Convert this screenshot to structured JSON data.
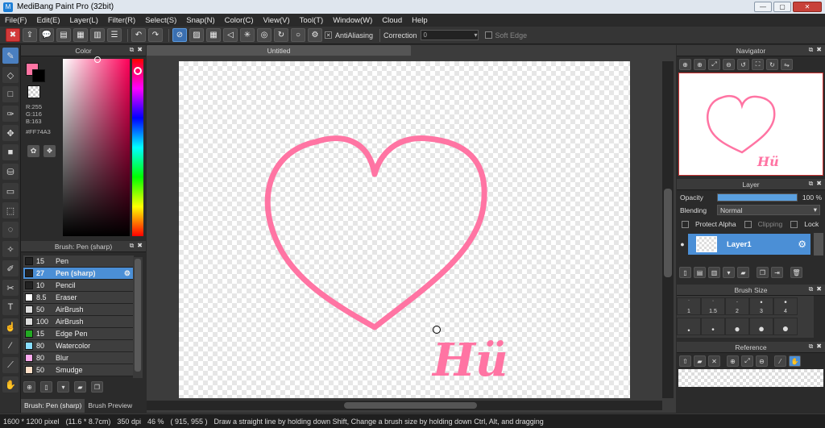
{
  "window": {
    "title": "MediBang Paint Pro (32bit)",
    "btn_min": "—",
    "btn_max": "▢",
    "btn_close": "✕"
  },
  "menu": [
    "File(F)",
    "Edit(E)",
    "Layer(L)",
    "Filter(R)",
    "Select(S)",
    "Snap(N)",
    "Color(C)",
    "View(V)",
    "Tool(T)",
    "Window(W)",
    "Cloud",
    "Help"
  ],
  "toolbar": {
    "antialiasing_label": "AntiAliasing",
    "correction_label": "Correction",
    "correction_value": "0",
    "soft_edge_label": "Soft Edge"
  },
  "color_panel": {
    "title": "Color",
    "r": "R:255",
    "g": "G:116",
    "b": "B:163",
    "hex": "#FF74A3",
    "fg_color": "#ff74a3"
  },
  "brush_panel": {
    "title": "Brush: Pen (sharp)",
    "items": [
      {
        "size": "15",
        "name": "Pen",
        "color": "#222222"
      },
      {
        "size": "27",
        "name": "Pen (sharp)",
        "color": "#222222"
      },
      {
        "size": "10",
        "name": "Pencil",
        "color": "#222222"
      },
      {
        "size": "8.5",
        "name": "Eraser",
        "color": "#ffffff"
      },
      {
        "size": "50",
        "name": "AirBrush",
        "color": "#dddddd"
      },
      {
        "size": "100",
        "name": "AirBrush",
        "color": "#dddddd"
      },
      {
        "size": "15",
        "name": "Edge Pen",
        "color": "#22aa22"
      },
      {
        "size": "80",
        "name": "Watercolor",
        "color": "#88ddff"
      },
      {
        "size": "80",
        "name": "Blur",
        "color": "#ffaaee"
      },
      {
        "size": "50",
        "name": "Smudge",
        "color": "#ffe0c8"
      }
    ],
    "tab_brush": "Brush: Pen (sharp)",
    "tab_preview": "Brush Preview"
  },
  "document": {
    "tab_title": "Untitled",
    "drawing_text": "Hü"
  },
  "navigator": {
    "title": "Navigator"
  },
  "layer_panel": {
    "title": "Layer",
    "opacity_label": "Opacity",
    "opacity_value": "100 %",
    "opacity": 1.0,
    "blending_label": "Blending",
    "blending_value": "Normal",
    "protect_alpha": "Protect Alpha",
    "clipping": "Clipping",
    "lock": "Lock",
    "layer_name": "Layer1"
  },
  "brush_size_panel": {
    "title": "Brush Size",
    "sizes": [
      "1",
      "1.5",
      "2",
      "3",
      "4"
    ]
  },
  "reference_panel": {
    "title": "Reference"
  },
  "status": {
    "dimensions": "1600 * 1200 pixel",
    "physical": "(11.6 * 8.7cm)",
    "dpi": "350 dpi",
    "zoom": "46 %",
    "cursor": "( 915, 955 )",
    "hint": "Draw a straight line by holding down Shift, Change a brush size by holding down Ctrl, Alt, and dragging"
  },
  "colors": {
    "accent": "#4b8fd6",
    "stroke": "#ff74a3"
  }
}
